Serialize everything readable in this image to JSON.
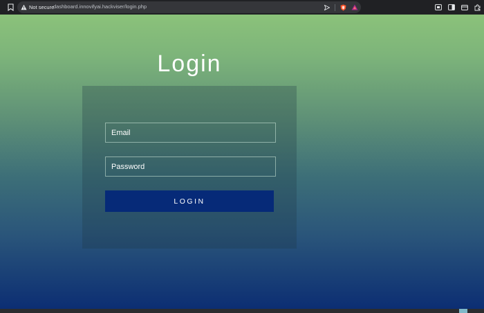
{
  "browser": {
    "security_label": "Not secure",
    "url": "dashboard.innovifyai.hackviser/login.php",
    "icons": {
      "bookmark": "bookmark-icon",
      "security": "warning-triangle-icon",
      "send": "send-to-device-icon",
      "brave": "brave-shield-icon",
      "rewards": "brave-rewards-icon",
      "screenshot": "screenshot-icon",
      "sidebar": "sidebar-icon",
      "wallet": "wallet-icon",
      "extensions": "puzzle-icon"
    }
  },
  "page": {
    "title": "Login",
    "email_placeholder": "Email",
    "password_placeholder": "Password",
    "login_button": "LOGIN"
  },
  "colors": {
    "gradient_top": "#8bc27a",
    "gradient_bottom": "#0c2e73",
    "button": "#062a78"
  }
}
